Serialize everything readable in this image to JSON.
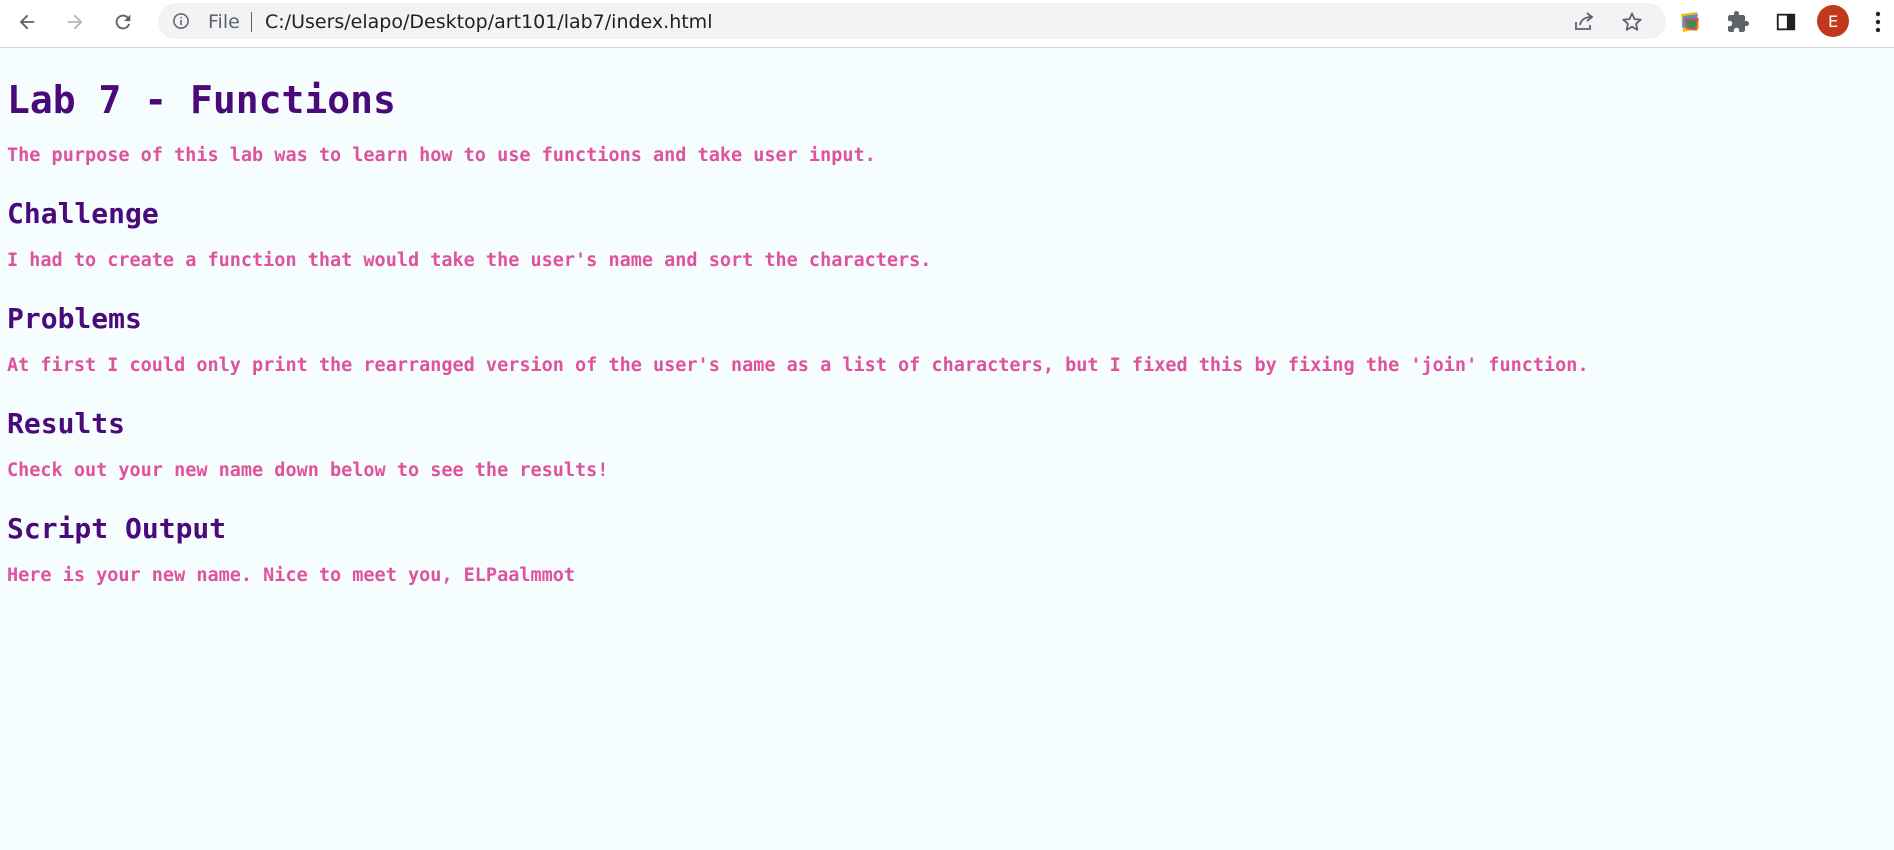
{
  "browser": {
    "url_scheme": "File",
    "url": "C:/Users/elapo/Desktop/art101/lab7/index.html",
    "avatar_letter": "E",
    "icons": {
      "back": "back-arrow-icon",
      "forward": "forward-arrow-icon",
      "reload": "reload-icon",
      "info": "info-icon",
      "share": "share-icon",
      "bookmark": "star-icon",
      "extension_app": "colorful-extension-icon",
      "extensions": "puzzle-icon",
      "side_panel": "side-panel-icon",
      "menu": "kebab-menu-icon"
    },
    "colors": {
      "avatar": "#c1381c",
      "omnibox": "#f1f3f4"
    }
  },
  "page": {
    "title": "Lab 7 - Functions",
    "intro": "The purpose of this lab was to learn how to use functions and take user input.",
    "sections": [
      {
        "heading": "Challenge",
        "text": "I had to create a function that would take the user's name and sort the characters."
      },
      {
        "heading": "Problems",
        "text": "At first I could only print the rearranged version of the user's name as a list of characters, but I fixed this by fixing the 'join' function."
      },
      {
        "heading": "Results",
        "text": "Check out your new name down below to see the results!"
      },
      {
        "heading": "Script Output",
        "text": "Here is your new name. Nice to meet you, ELPaalmmot"
      }
    ],
    "colors": {
      "background": "#f5fdff",
      "heading": "#4b0a7a",
      "body_text": "#e0529c"
    }
  }
}
